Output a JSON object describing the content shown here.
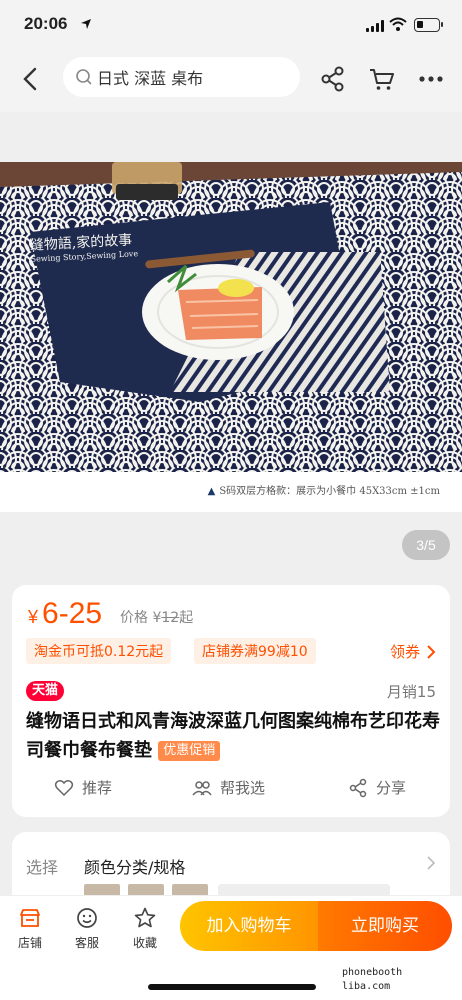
{
  "status_bar": {
    "time": "20:06"
  },
  "search": {
    "query": "日式 深蓝 桌布"
  },
  "gallery": {
    "photo_watermark": "缝物語,家的故事",
    "photo_watermark_sub": "Sewing Story,Sewing Love",
    "caption": "S码双层方格款：展示为小餐巾 45X33cm ±1cm",
    "counter": "3/5"
  },
  "product": {
    "currency": "¥",
    "price_range": "6-25",
    "price_label": "价格",
    "original_currency": "¥",
    "original_price": "12",
    "original_suffix": "起",
    "tag_coin": "淘金币可抵0.12元起",
    "tag_shop_coupon": "店铺券满99减10",
    "coupon_label": "领券",
    "store_badge": "天猫",
    "monthly_sales": "月销15",
    "title": "缝物语日式和风青海波深蓝几何图案纯棉布艺印花寿司餐巾餐布餐垫",
    "promo_badge": "优惠促销",
    "actions": {
      "recommend": "推荐",
      "help_choose": "帮我选",
      "share": "分享"
    }
  },
  "spec": {
    "label": "选择",
    "value": "颜色分类/规格"
  },
  "bottom_bar": {
    "store": "店铺",
    "service": "客服",
    "favorite": "收藏",
    "add_to_cart": "加入购物车",
    "buy_now": "立即购买"
  },
  "watermark": {
    "line1": "phonebooth",
    "line2": "liba.com"
  },
  "colors": {
    "accent": "#ff5000",
    "tmall": "#ff0036",
    "cart_button": "#ffb400",
    "buy_button": "#ff5a00",
    "navy": "#1b2448"
  }
}
